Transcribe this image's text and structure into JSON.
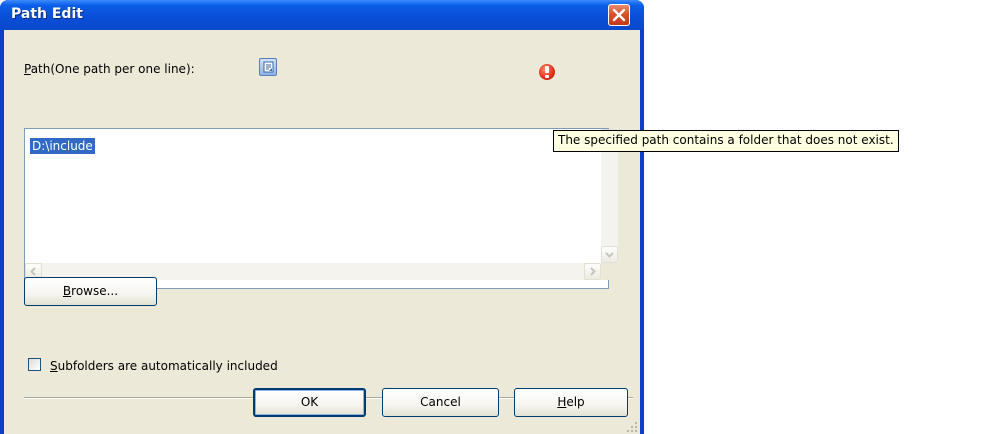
{
  "window": {
    "title": "Path Edit",
    "accent": "#0a4fd8"
  },
  "path_field": {
    "label_prefix": "P",
    "label_rest": "ath(One path per one line):",
    "value": "D:\\include",
    "info_icon": "info-icon",
    "error_icon": "error-icon"
  },
  "tooltip": {
    "text": "The specified path contains a folder that does not exist."
  },
  "browse_button": {
    "prefix": "B",
    "rest": "rowse..."
  },
  "subfolders_checkbox": {
    "prefix": "S",
    "rest": "ubfolders are automatically included",
    "checked": false
  },
  "footer": {
    "ok_label": "OK",
    "cancel_label": "Cancel",
    "help_prefix": "H",
    "help_rest": "elp"
  }
}
